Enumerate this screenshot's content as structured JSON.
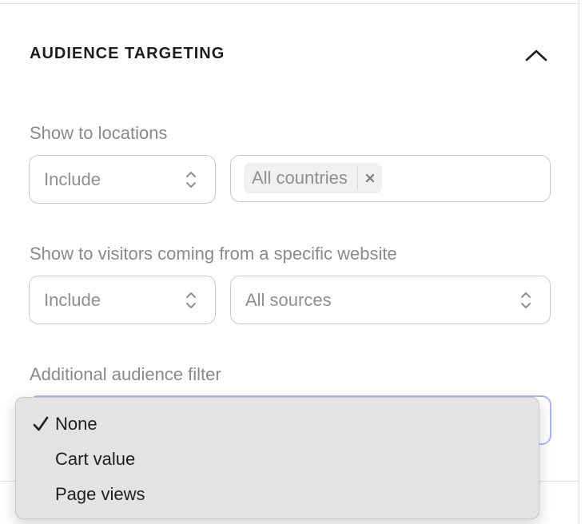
{
  "section": {
    "title": "AUDIENCE TARGETING"
  },
  "locations": {
    "label": "Show to locations",
    "mode_value": "Include",
    "tags": [
      "All countries"
    ]
  },
  "referrer": {
    "label": "Show to visitors coming from a specific website",
    "mode_value": "Include",
    "source_value": "All sources"
  },
  "audience_filter": {
    "label": "Additional audience filter",
    "selected": "None",
    "options": [
      "None",
      "Cart value",
      "Page views"
    ]
  },
  "icons": {
    "collapse": "chevron-up-icon",
    "select": "chevron-up-down-icon",
    "remove": "close-icon",
    "check": "checkmark-icon"
  },
  "colors": {
    "focus_ring": "#aeb4f0",
    "label": "#8a8a8a",
    "menu_bg": "#e3e3e3"
  }
}
